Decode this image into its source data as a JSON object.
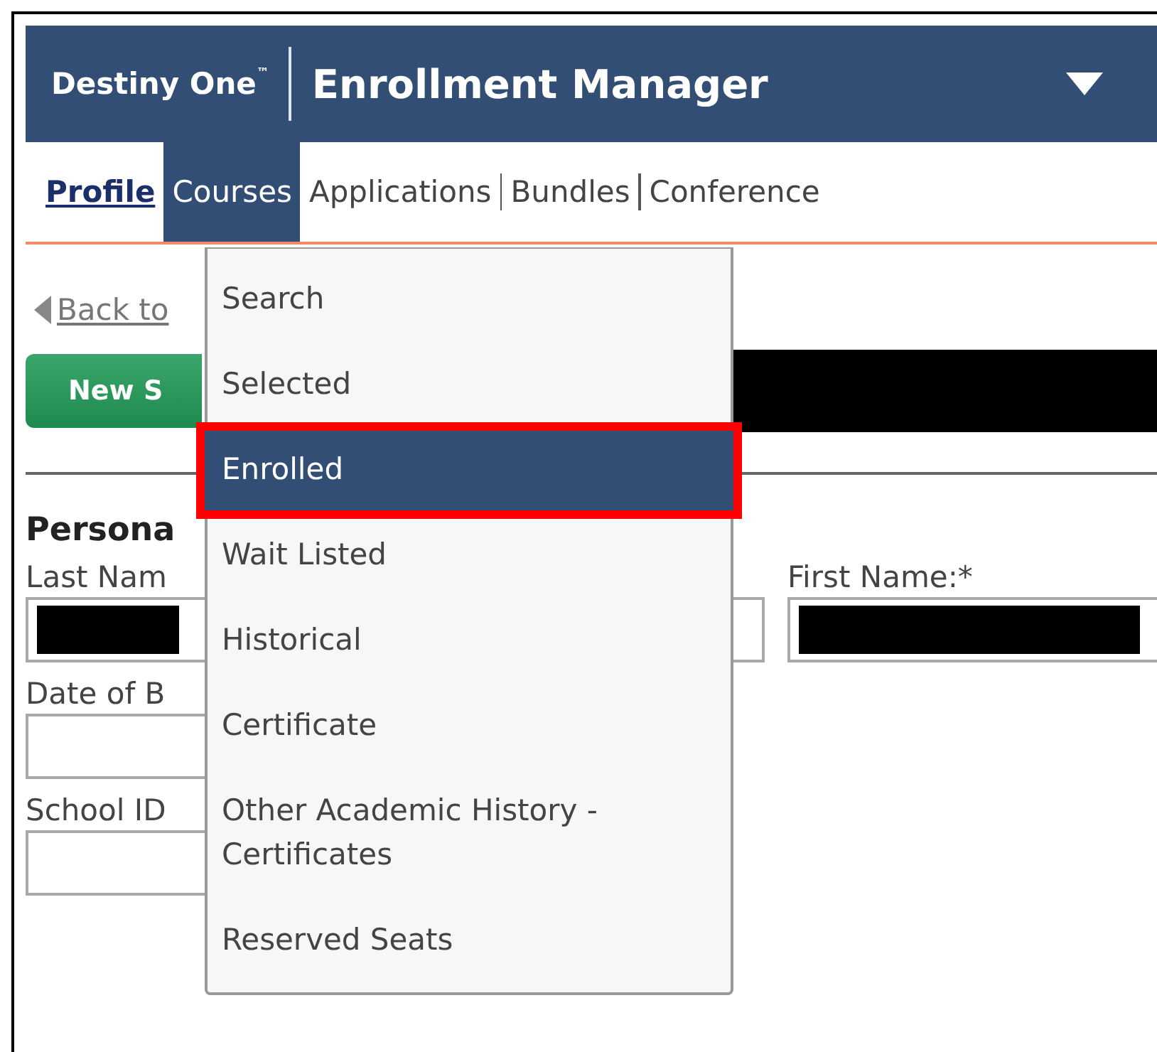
{
  "header": {
    "brand": "Destiny One",
    "trademark": "™",
    "title": "Enrollment Manager"
  },
  "nav": [
    {
      "label": "Profile",
      "selected": false,
      "current": true
    },
    {
      "label": "Courses",
      "selected": true,
      "current": false
    },
    {
      "label": "Applications",
      "selected": false,
      "current": false
    },
    {
      "label": "Bundles",
      "selected": false,
      "current": false
    },
    {
      "label": "Conference",
      "selected": false,
      "current": false
    }
  ],
  "back_link": "Back to",
  "new_button": "New S",
  "section_title": "Persona",
  "fields": {
    "last_name_label": "Last Nam",
    "first_name_label": "First Name:*",
    "dob_label": "Date of B",
    "school_id_label": "School ID"
  },
  "menu": [
    {
      "label": "Search",
      "selected": false
    },
    {
      "label": "Selected",
      "selected": false
    },
    {
      "label": "Enrolled",
      "selected": true
    },
    {
      "label": "Wait Listed",
      "selected": false
    },
    {
      "label": "Historical",
      "selected": false
    },
    {
      "label": "Certificate",
      "selected": false
    },
    {
      "label": "Other Academic History - Certificates",
      "selected": false
    },
    {
      "label": "Reserved Seats",
      "selected": false
    }
  ]
}
